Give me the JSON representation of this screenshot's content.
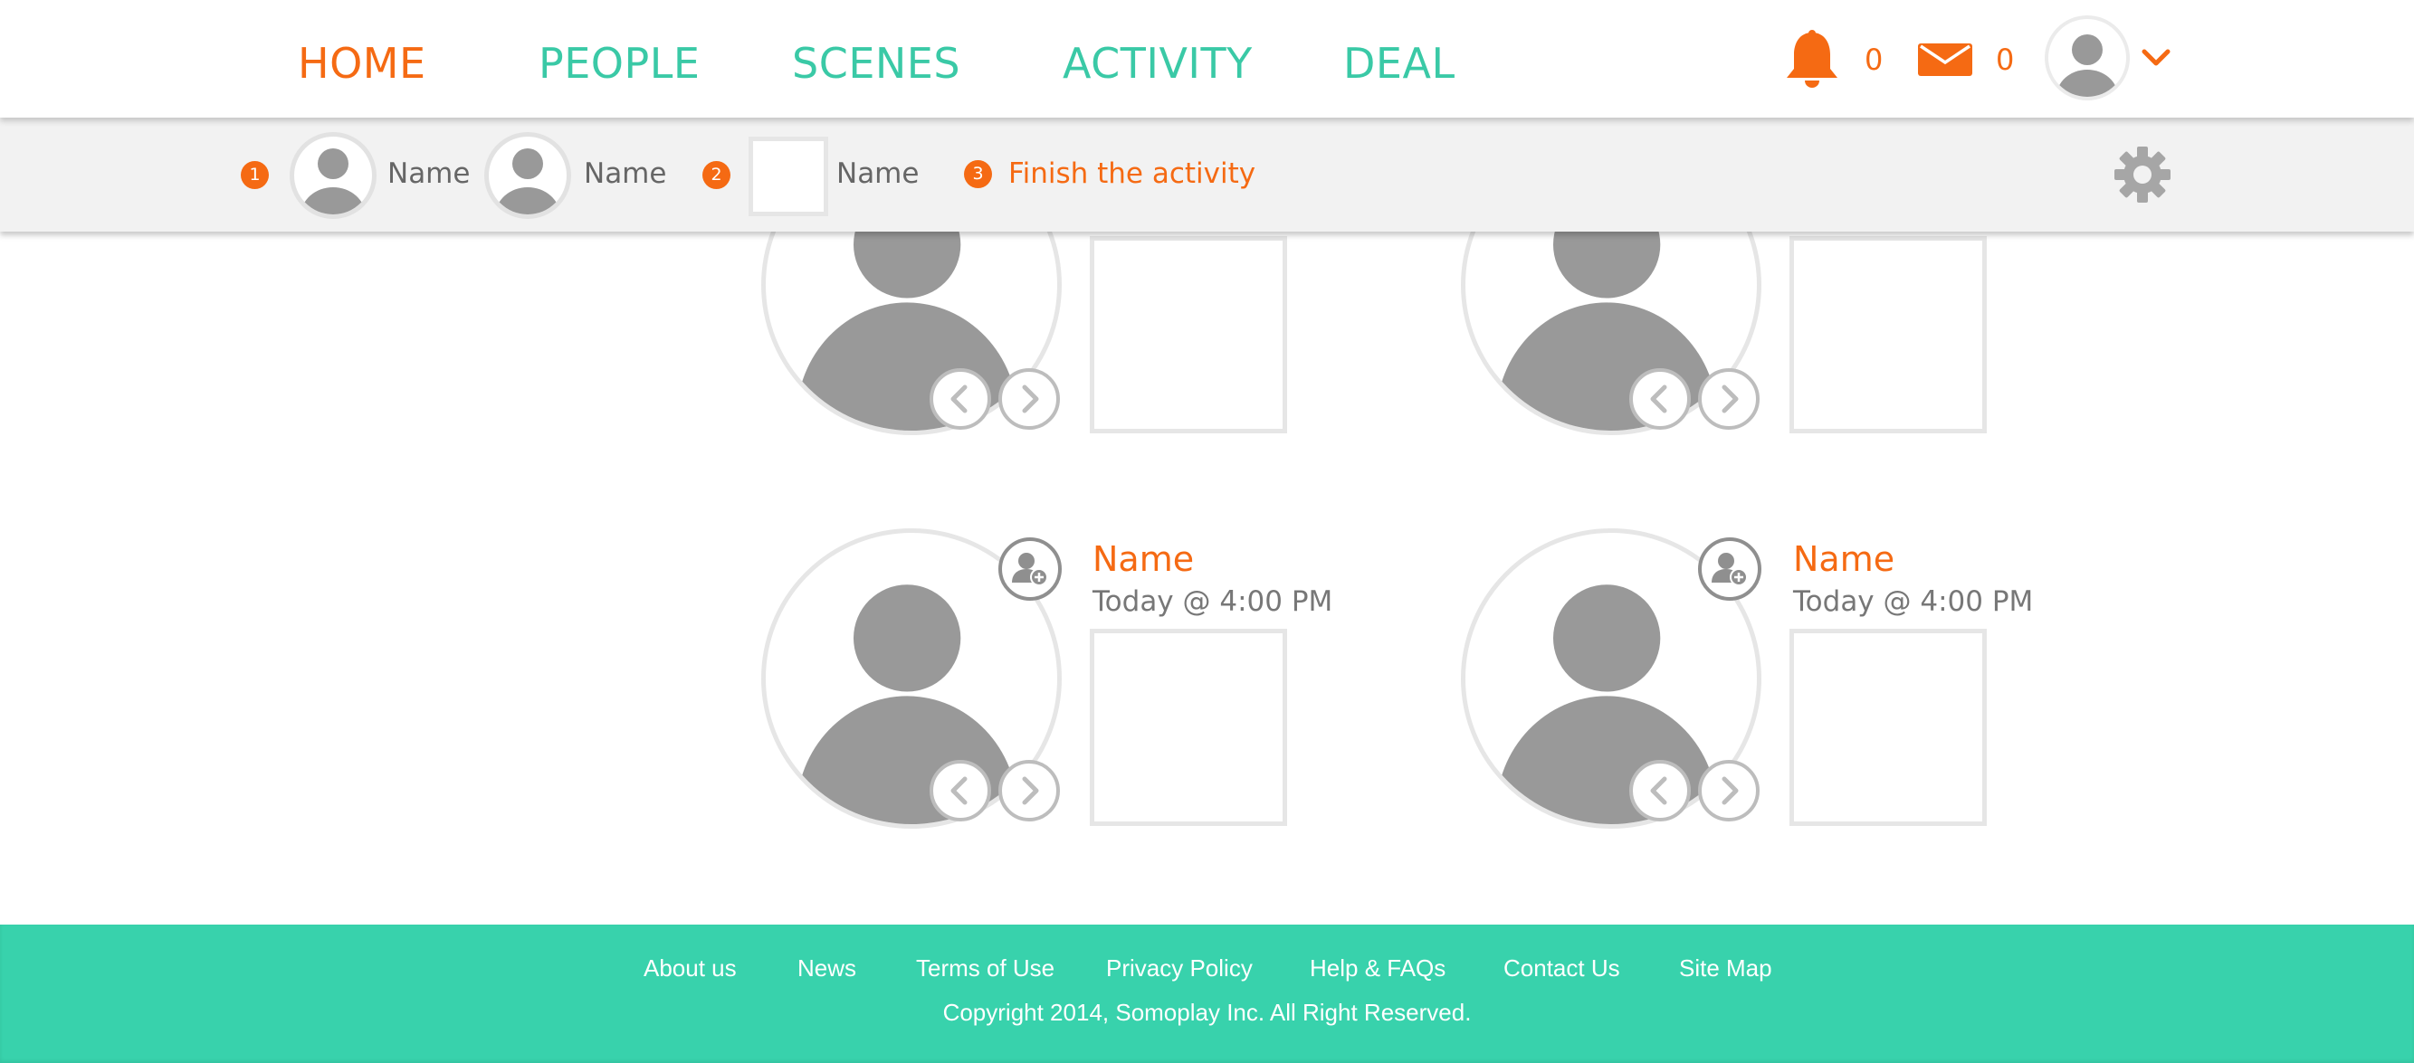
{
  "nav": {
    "items": [
      {
        "label": "HOME",
        "active": true
      },
      {
        "label": "PEOPLE",
        "active": false
      },
      {
        "label": "SCENES",
        "active": false
      },
      {
        "label": "ACTIVITY",
        "active": false
      },
      {
        "label": "DEAL",
        "active": false
      }
    ],
    "notification_count": "0",
    "message_count": "0",
    "icons": [
      "bell-icon",
      "envelope-icon",
      "user-avatar",
      "chevron-down-icon"
    ]
  },
  "activity_bar": {
    "steps": [
      "1",
      "2",
      "3"
    ],
    "step1_names": [
      "Name",
      "Name"
    ],
    "step2_name": "Name",
    "finish_label": "Finish the activity",
    "icons": [
      "gear-icon"
    ]
  },
  "cards": [
    {
      "name": "",
      "time": ""
    },
    {
      "name": "",
      "time": ""
    },
    {
      "name": "Name",
      "time": "Today @ 4:00 PM"
    },
    {
      "name": "Name",
      "time": "Today @ 4:00 PM"
    }
  ],
  "footer": {
    "links": [
      "About us",
      "News",
      "Terms of Use",
      "Privacy Policy",
      "Help & FAQs",
      "Contact Us",
      "Site Map"
    ],
    "copyright": "Copyright 2014, Somoplay Inc. All Right Reserved."
  },
  "colors": {
    "accent_orange": "#f56a13",
    "accent_teal": "#3ac9a6",
    "footer_teal": "#38d2ac",
    "avatar_gray": "#999999",
    "border_gray": "#e6e6e6"
  }
}
